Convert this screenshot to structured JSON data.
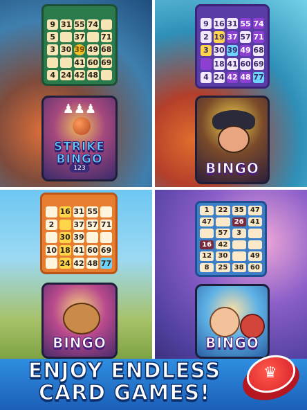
{
  "colors": {
    "banner_text": "#ffffff",
    "banner_bg": "#2f8ee0",
    "chip": "#d8202a"
  },
  "quad1": {
    "card": {
      "cells": [
        "9",
        "31",
        "55",
        "74",
        "",
        "5",
        "",
        "37",
        "",
        "71",
        "3",
        "30",
        "39",
        "49",
        "68",
        "",
        "",
        "41",
        "60",
        "69",
        "4",
        "24",
        "42",
        "48",
        ""
      ],
      "marked": {
        "free": [
          12
        ],
        "yellow": []
      }
    },
    "art": {
      "title_1": "STRIKE",
      "title_2": "BINGO",
      "badge": "123"
    }
  },
  "quad2": {
    "card": {
      "cells": [
        "9",
        "16",
        "31",
        "55",
        "74",
        "2",
        "19",
        "37",
        "57",
        "71",
        "3",
        "30",
        "39",
        "49",
        "68",
        "",
        "18",
        "41",
        "60",
        "69",
        "4",
        "24",
        "42",
        "48",
        "77"
      ],
      "marked": {
        "purple": [
          3,
          4,
          7,
          9,
          13,
          15,
          22,
          23
        ],
        "yellow": [
          6,
          10
        ],
        "blue": [
          12,
          24
        ]
      }
    },
    "art": {
      "title": "BINGO"
    }
  },
  "quad3": {
    "card": {
      "cells": [
        "",
        "16",
        "31",
        "55",
        "",
        "2",
        "",
        "37",
        "57",
        "71",
        "",
        "30",
        "39",
        "",
        "",
        "10",
        "18",
        "41",
        "60",
        "69",
        "",
        "24",
        "42",
        "48",
        "77"
      ],
      "marked": {
        "yellow": [
          1,
          6,
          11,
          16,
          21
        ],
        "blue": [
          24
        ]
      }
    },
    "art": {
      "title": "BINGO"
    }
  },
  "quad4": {
    "card": {
      "cells": [
        "1",
        "22",
        "35",
        "47",
        "47",
        "",
        "26",
        "41",
        "",
        "57",
        "3",
        "",
        "16",
        "42",
        "",
        "",
        "12",
        "30",
        "",
        "49",
        "8",
        "25",
        "38",
        "60"
      ],
      "marked": {
        "red": [
          6,
          12
        ]
      }
    },
    "art": {
      "title": "BINGO"
    }
  },
  "banner": {
    "line1": "ENJOY ENDLESS",
    "line2": "CARD GAMES!"
  }
}
